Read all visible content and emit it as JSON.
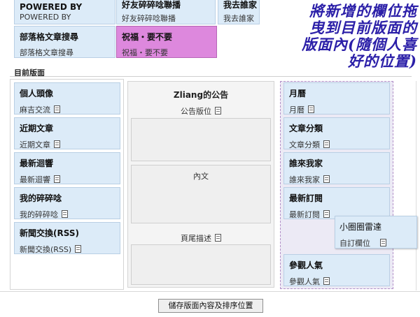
{
  "top_widgets": [
    {
      "title": "POWERED BY",
      "sub": "POWERED BY"
    },
    {
      "title": "好友碎碎唸聯播",
      "sub": "好友碎碎唸聯播"
    },
    {
      "title": "我去誰家",
      "sub": "我去誰家"
    },
    {
      "title": "部落格文章搜尋",
      "sub": "部落格文章搜尋"
    },
    {
      "title": "祝福・要不要",
      "sub": "祝福・要不要"
    }
  ],
  "section_label": "目前版面",
  "left_column": [
    {
      "title": "個人頭像",
      "sub": "麻吉交流"
    },
    {
      "title": "近期文章",
      "sub": "近期文章"
    },
    {
      "title": "最新迴響",
      "sub": "最新迴響"
    },
    {
      "title": "我的碎碎唸",
      "sub": "我的碎碎唸"
    },
    {
      "title": "新聞交換(RSS)",
      "sub": "新聞交換(RSS)"
    }
  ],
  "middle_column": {
    "title": "Zliang的公告",
    "announce_caption": "公告版位",
    "content_caption": "內文",
    "footer_caption": "頁尾描述"
  },
  "right_column": [
    {
      "title": "月曆",
      "sub": "月曆"
    },
    {
      "title": "文章分類",
      "sub": "文章分類"
    },
    {
      "title": "誰來我家",
      "sub": "誰來我家"
    },
    {
      "title": "最新訂閱",
      "sub": "最新訂閱"
    },
    {
      "title": "參觀人氣",
      "sub": "參觀人氣"
    }
  ],
  "dragging_widget": {
    "title": "小圈圈雷達",
    "sub": "自訂欄位"
  },
  "annotation": "將新增的欄位拖曳到目前版面的版面內(隨個人喜好的位置)",
  "annotation_lines": [
    "將新增的欄位拖",
    "曳到目前版面的",
    "版面內(隨個人喜",
    "好的位置)"
  ],
  "save_button": "儲存版面內容及排序位置"
}
